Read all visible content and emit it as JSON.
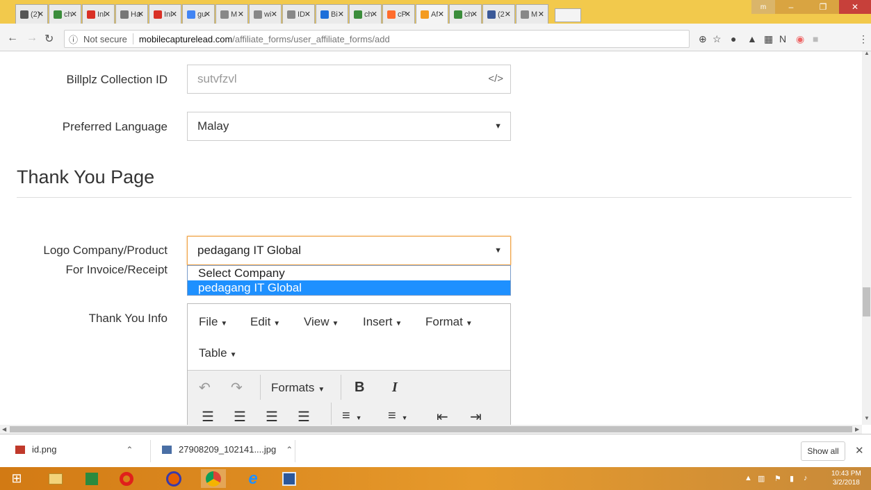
{
  "browser": {
    "tabs": [
      {
        "label": "(2)",
        "color": "#555555"
      },
      {
        "label": "ch",
        "color": "#3b8d3b"
      },
      {
        "label": "Inl",
        "color": "#d93025"
      },
      {
        "label": "Ha",
        "color": "#777777"
      },
      {
        "label": "Inl",
        "color": "#d93025"
      },
      {
        "label": "gu",
        "color": "#4285f4"
      },
      {
        "label": "M",
        "color": "#888888"
      },
      {
        "label": "wi",
        "color": "#888888"
      },
      {
        "label": "ID",
        "color": "#888888"
      },
      {
        "label": "Bi",
        "color": "#1e6fd9"
      },
      {
        "label": "ch",
        "color": "#3b8d3b"
      },
      {
        "label": "cP",
        "color": "#ff6c2c"
      },
      {
        "label": "Af",
        "color": "#f49b20"
      },
      {
        "label": "ch",
        "color": "#3b8d3b"
      },
      {
        "label": "(2",
        "color": "#3b5998"
      },
      {
        "label": "M",
        "color": "#888888"
      }
    ],
    "active_tab_index": 12,
    "security_label": "Not secure",
    "url_host": "mobilecapturelead.com",
    "url_path": "/affiliate_forms/user_affiliate_forms/add"
  },
  "form": {
    "billplz_label": "Billplz Collection ID",
    "billplz_value": "sutvfzvl",
    "language_label": "Preferred Language",
    "language_value": "Malay",
    "section_title": "Thank You Page",
    "logo_label_line1": "Logo Company/Product",
    "logo_label_line2": "For Invoice/Receipt",
    "logo_value": "pedagang IT Global",
    "logo_options": [
      "Select Company",
      "pedagang IT Global"
    ],
    "thank_you_label": "Thank You Info"
  },
  "editor": {
    "menus": [
      "File",
      "Edit",
      "View",
      "Insert",
      "Format",
      "Table"
    ],
    "formats_label": "Formats",
    "bold_label": "B",
    "italic_label": "I"
  },
  "downloads": {
    "items": [
      "id.png",
      "27908209_102141....jpg"
    ],
    "show_all": "Show all"
  },
  "taskbar": {
    "time": "10:43 PM",
    "date": "3/2/2018"
  }
}
